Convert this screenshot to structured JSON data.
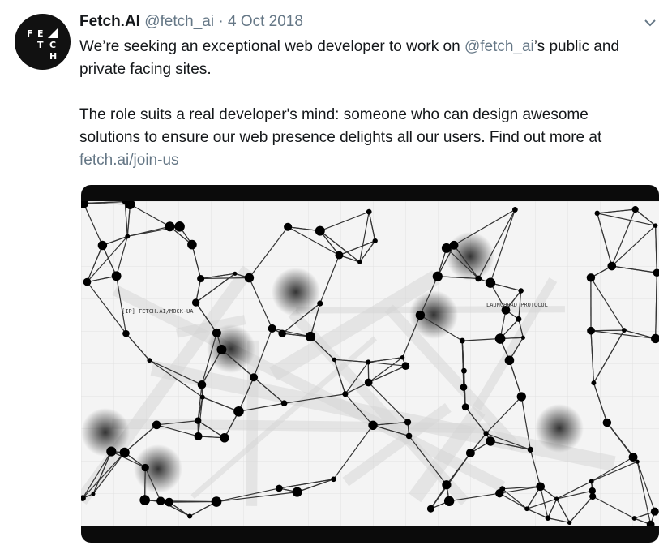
{
  "tweet": {
    "avatar_letters": [
      "F",
      "E",
      "T",
      "C",
      "H"
    ],
    "display_name": "Fetch.AI",
    "handle": "@fetch_ai",
    "separator": "·",
    "date": "4 Oct 2018",
    "para1_before": "We’re seeking an exceptional web developer to work on ",
    "mention": "@fetch_ai",
    "para1_after": "’s public and private facing sites.",
    "para2": "The role suits a real developer's mind: someone who can design awesome solutions to ensure our web presence delights all our users. Find out more at ",
    "link": "fetch.ai/join-us"
  },
  "media": {
    "labels": [
      "[IP] FETCH.AI/MOCK-UA",
      "LAUNCHPAD PROTOCOL"
    ],
    "colors": {
      "nodes": "#000000",
      "lines": "#222222",
      "background": "#f4f4f4"
    }
  },
  "icons": {
    "menu": "chevron-down-icon"
  }
}
